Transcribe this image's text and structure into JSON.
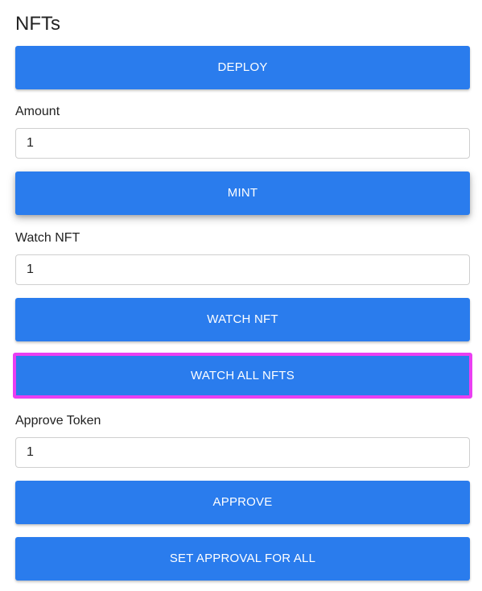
{
  "section": {
    "title": "NFTs"
  },
  "buttons": {
    "deploy": "DEPLOY",
    "mint": "MINT",
    "watch_nft": "WATCH NFT",
    "watch_all_nfts": "WATCH ALL NFTS",
    "approve": "APPROVE",
    "set_approval_for_all": "SET APPROVAL FOR ALL"
  },
  "fields": {
    "amount": {
      "label": "Amount",
      "value": "1"
    },
    "watch_nft": {
      "label": "Watch NFT",
      "value": "1"
    },
    "approve_token": {
      "label": "Approve Token",
      "value": "1"
    }
  },
  "colors": {
    "button_bg": "#2a7ced",
    "button_text": "#ffffff",
    "focus_ring": "#ea3ff2"
  }
}
